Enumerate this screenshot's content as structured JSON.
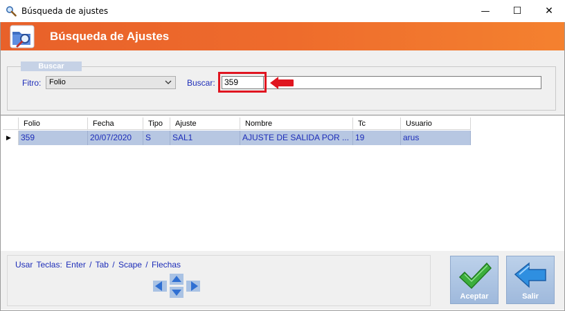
{
  "window": {
    "title": "Búsqueda de ajustes",
    "minimize_glyph": "—",
    "maximize_glyph": "☐",
    "close_glyph": "✕"
  },
  "header": {
    "title": "Búsqueda de Ajustes"
  },
  "search_group": {
    "legend": "Buscar",
    "filter_label": "Fitro:",
    "filter_selected": "Folio",
    "search_label": "Buscar:",
    "search_value": "359"
  },
  "grid": {
    "columns": [
      "Folio",
      "Fecha",
      "Tipo",
      "Ajuste",
      "Nombre",
      "Tc",
      "Usuario"
    ],
    "rows": [
      [
        "359",
        "20/07/2020",
        "S",
        "SAL1",
        "AJUSTE DE SALIDA POR ...",
        "19",
        "arus"
      ]
    ],
    "row_indicator": "▶"
  },
  "footer": {
    "keys_text": "Usar Teclas:  Enter  /  Tab  /  Scape  /  Flechas",
    "accept_label": "Aceptar",
    "exit_label": "Salir"
  },
  "colors": {
    "header_orange": "#ee6b2c",
    "selected_row": "#b7c7e2",
    "text_blue": "#1c2cb8",
    "highlight_red": "#e01520"
  }
}
